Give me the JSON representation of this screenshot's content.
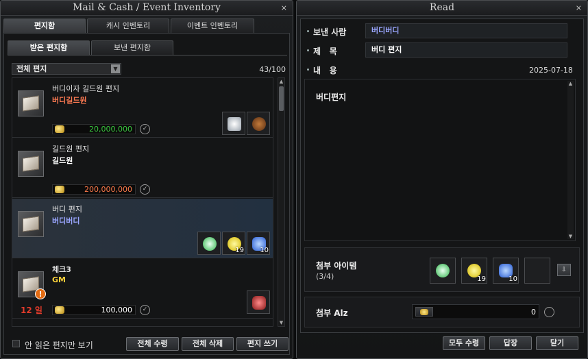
{
  "inventory": {
    "title": "Mail & Cash / Event Inventory",
    "close": "×",
    "tabs": [
      {
        "label": "편지함"
      },
      {
        "label": "캐시 인벤토리"
      },
      {
        "label": "이벤트 인벤토리"
      }
    ],
    "subtabs": [
      {
        "label": "받은 편지함"
      },
      {
        "label": "보낸 편지함"
      }
    ],
    "filter": "전체 편지",
    "count": "43/100",
    "mails": [
      {
        "title": "버디이자 길드원 편지",
        "sender": "버디길드원",
        "sender_color": "#ff7a52",
        "alz": "20,000,000",
        "alz_color": "#39c93e",
        "attachments": [
          "silver-relic-icon",
          "brown-gem-icon"
        ]
      },
      {
        "title": "길드원 편지",
        "sender": "길드원",
        "sender_color": "#ffffff",
        "alz": "200,000,000",
        "alz_color": "#ff7a4a",
        "attachments": []
      },
      {
        "title": "버디 편지",
        "sender": "버디버디",
        "sender_color": "#9aa6ff",
        "alz": "",
        "alz_color": "#ffffff",
        "attachments": [
          "green-crystal-icon",
          "yellow-orb-icon",
          "blue-potion-icon"
        ],
        "qty": [
          "",
          "19",
          "10"
        ]
      },
      {
        "title": "체크3",
        "sender": "GM",
        "sender_color": "#ffd23a",
        "alz": "100,000",
        "alz_color": "#ffffff",
        "days": "12 일",
        "attachments": [
          "red-crystal-icon"
        ]
      }
    ],
    "unread_only": "안 읽은 편지만 보기",
    "buttons": {
      "receive_all": "전체 수령",
      "delete_all": "전체 삭제",
      "write": "편지 쓰기"
    }
  },
  "read": {
    "title": "Read",
    "close": "×",
    "sender_label": "보낸 사람",
    "sender_value": "버디버디",
    "subject_label": "제   목",
    "subject_value": "버디 편지",
    "content_label": "내   용",
    "date": "2025-07-18",
    "content": "버디편지",
    "attach_label": "첨부 아이템",
    "attach_count": "(3/4)",
    "attach_items": [
      {
        "icon": "green-crystal-icon",
        "qty": ""
      },
      {
        "icon": "yellow-orb-icon",
        "qty": "19"
      },
      {
        "icon": "blue-potion-icon",
        "qty": "10"
      }
    ],
    "alz_label": "첨부 Alz",
    "alz_value": "0",
    "buttons": {
      "receive_all": "모두 수령",
      "reply": "답장",
      "close": "닫기"
    }
  },
  "colors": {
    "accent_blue": "#9aa6ff",
    "alert_red": "#e23b2b"
  }
}
